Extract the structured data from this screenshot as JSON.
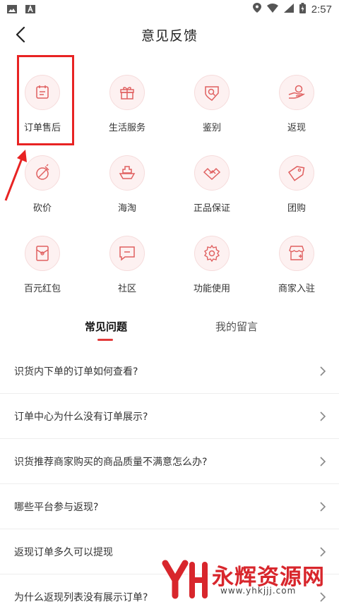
{
  "status_bar": {
    "time": "2:57"
  },
  "header": {
    "title": "意见反馈"
  },
  "categories": [
    {
      "label": "订单售后",
      "icon": "order-icon"
    },
    {
      "label": "生活服务",
      "icon": "gift-icon"
    },
    {
      "label": "鉴别",
      "icon": "shield-search-icon"
    },
    {
      "label": "返现",
      "icon": "cashback-icon"
    },
    {
      "label": "砍价",
      "icon": "bargain-icon"
    },
    {
      "label": "海淘",
      "icon": "ship-icon"
    },
    {
      "label": "正品保证",
      "icon": "handshake-icon"
    },
    {
      "label": "团购",
      "icon": "tag-icon"
    },
    {
      "label": "百元红包",
      "icon": "red-packet-icon"
    },
    {
      "label": "社区",
      "icon": "chat-icon"
    },
    {
      "label": "功能使用",
      "icon": "gear-icon"
    },
    {
      "label": "商家入驻",
      "icon": "store-icon"
    }
  ],
  "tabs": [
    {
      "label": "常见问题",
      "active": true
    },
    {
      "label": "我的留言",
      "active": false
    }
  ],
  "faq": [
    "识货内下单的订单如何查看?",
    "订单中心为什么没有订单展示?",
    "识货推荐商家购买的商品质量不满意怎么办?",
    "哪些平台参与返现?",
    "返现订单多久可以提现",
    "为什么返现列表没有展示订单?"
  ],
  "watermark": {
    "title": "永辉资源网",
    "url": "www.yhkjjj.com"
  },
  "colors": {
    "accent": "#e23a3a",
    "icon_bg": "#fdf1f1",
    "highlight": "#e82323"
  }
}
